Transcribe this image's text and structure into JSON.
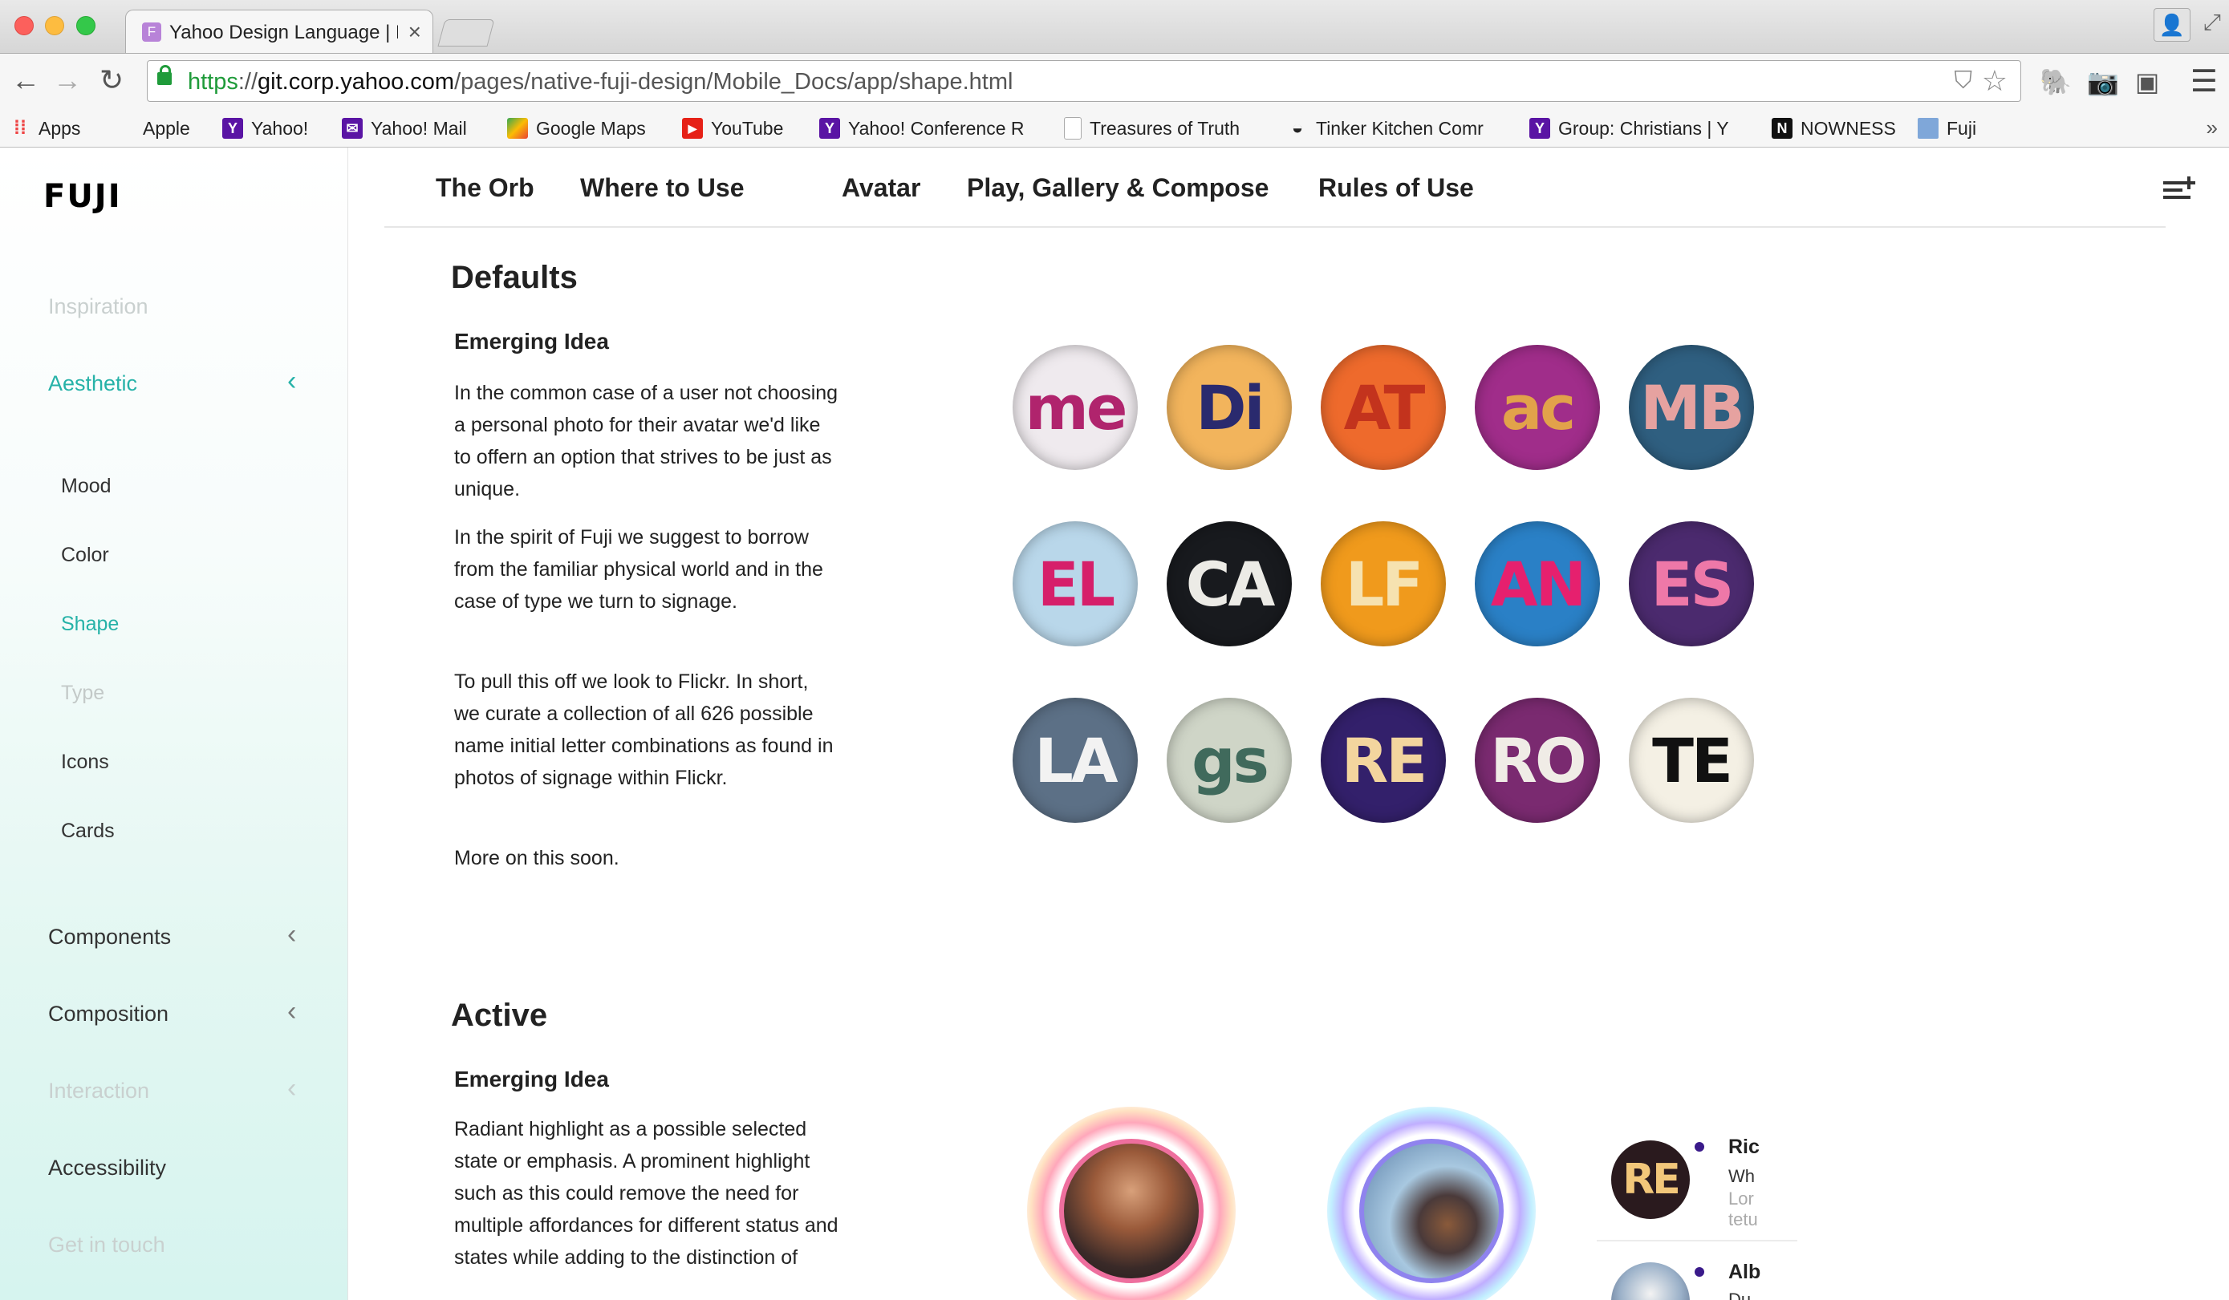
{
  "browser": {
    "tab_title": "Yahoo Design Language | Fuji",
    "tab_favicon": "F",
    "url_scheme": "https",
    "url_sep": "://",
    "url_host": "git.corp.yahoo.com",
    "url_path": "/pages/native-fuji-design/Mobile_Docs/app/shape.html",
    "bookmarks": [
      {
        "label": "Apps",
        "icon": "apps-grid-icon"
      },
      {
        "label": "Apple",
        "icon": "apple-icon"
      },
      {
        "label": "Yahoo!",
        "icon": "yahoo-icon"
      },
      {
        "label": "Yahoo! Mail",
        "icon": "mail-icon"
      },
      {
        "label": "Google Maps",
        "icon": "maps-icon"
      },
      {
        "label": "YouTube",
        "icon": "youtube-icon"
      },
      {
        "label": "Yahoo! Conference R",
        "icon": "yahoo-icon"
      },
      {
        "label": "Treasures of Truth",
        "icon": "document-icon"
      },
      {
        "label": "Tinker Kitchen Comr",
        "icon": "pot-icon"
      },
      {
        "label": "Group: Christians | Y",
        "icon": "yahoo-icon"
      },
      {
        "label": "NOWNESS",
        "icon": "nowness-icon"
      },
      {
        "label": "Fuji",
        "icon": "folder-icon"
      }
    ]
  },
  "sidebar": {
    "logo": "FUJI",
    "items": [
      {
        "label": "Inspiration"
      },
      {
        "label": "Aesthetic"
      },
      {
        "label": "Mood"
      },
      {
        "label": "Color"
      },
      {
        "label": "Shape"
      },
      {
        "label": "Type"
      },
      {
        "label": "Icons"
      },
      {
        "label": "Cards"
      },
      {
        "label": "Components"
      },
      {
        "label": "Composition"
      },
      {
        "label": "Interaction"
      },
      {
        "label": "Accessibility"
      },
      {
        "label": "Get in touch"
      }
    ]
  },
  "page_tabs": [
    "The Orb",
    "Where to Use",
    "Avatar",
    "Play, Gallery & Compose",
    "Rules of Use"
  ],
  "defaults": {
    "heading": "Defaults",
    "subheading": "Emerging Idea",
    "paragraphs": [
      "In the common case of a user not choosing a personal photo for their avatar we'd like to offern an option that strives to be just as unique.",
      "In the spirit of Fuji we suggest to borrow from the familiar physical world and in the case of type we turn to signage.",
      "To pull this off we look to Flickr. In short, we curate a collection of all 626 possible name initial letter combinations as found in photos of signage within Flickr.",
      "More on this soon."
    ],
    "avatars": [
      {
        "text": "me",
        "bg": "#efeaee",
        "fg": "#b0246d"
      },
      {
        "text": "Di",
        "bg": "#f2b45c",
        "fg": "#2a2a6e"
      },
      {
        "text": "AT",
        "bg": "#ee6a2c",
        "fg": "#c3331d"
      },
      {
        "text": "ac",
        "bg": "#a02d8a",
        "fg": "#e2a24a"
      },
      {
        "text": "MB",
        "bg": "#2f5f80",
        "fg": "#e6a2a0"
      },
      {
        "text": "EL",
        "bg": "#b9d7ea",
        "fg": "#d61f6a"
      },
      {
        "text": "CA",
        "bg": "#181a1e",
        "fg": "#ecebe6"
      },
      {
        "text": "LF",
        "bg": "#f09a1c",
        "fg": "#f6e2b0"
      },
      {
        "text": "AN",
        "bg": "#2a80c6",
        "fg": "#e6206e"
      },
      {
        "text": "ES",
        "bg": "#4b2a6e",
        "fg": "#ee78a8"
      },
      {
        "text": "LA",
        "bg": "#5c7086",
        "fg": "#f2f2f2"
      },
      {
        "text": "gs",
        "bg": "#cfd5c7",
        "fg": "#406a5c"
      },
      {
        "text": "RE",
        "bg": "#33206b",
        "fg": "#f3d59e"
      },
      {
        "text": "RO",
        "bg": "#7a2a70",
        "fg": "#f0ece6"
      },
      {
        "text": "TE",
        "bg": "#f4f0e4",
        "fg": "#111111"
      }
    ]
  },
  "active": {
    "heading": "Active",
    "subheading": "Emerging Idea",
    "paragraphs": [
      "Radiant highlight as a possible selected state or emphasis. A prominent highlight such as this could remove the need for multiple affordances for different status and states while adding to the distinction of"
    ],
    "list": [
      {
        "avatar_text": "RE",
        "name": "Ric",
        "line1": "Wh",
        "line2": "Lor",
        "line3": "tetu"
      },
      {
        "name": "Alb",
        "line1": "Du"
      }
    ]
  }
}
